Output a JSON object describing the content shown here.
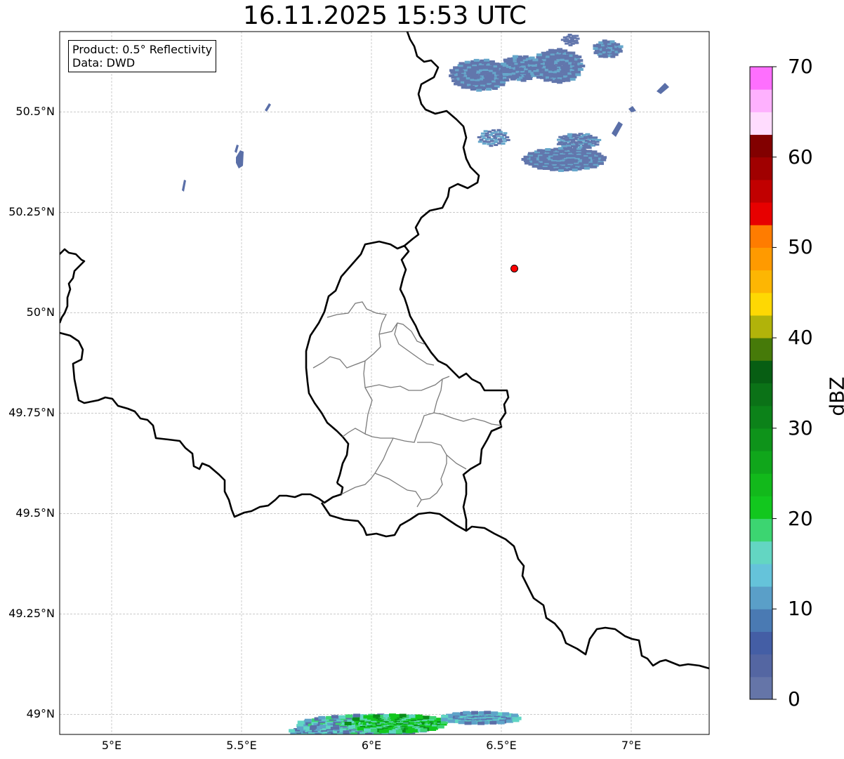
{
  "title": "16.11.2025 15:53 UTC",
  "info": {
    "product": "Product: 0.5° Reflectivity",
    "data": "Data: DWD"
  },
  "map": {
    "lon_range": [
      4.8,
      7.3
    ],
    "lat_range": [
      48.95,
      50.7
    ],
    "lon_ticks": [
      {
        "v": 5.0,
        "label": "5°E"
      },
      {
        "v": 5.5,
        "label": "5.5°E"
      },
      {
        "v": 6.0,
        "label": "6°E"
      },
      {
        "v": 6.5,
        "label": "6.5°E"
      },
      {
        "v": 7.0,
        "label": "7°E"
      }
    ],
    "lat_ticks": [
      {
        "v": 49.0,
        "label": "49°N"
      },
      {
        "v": 49.25,
        "label": "49.25°N"
      },
      {
        "v": 49.5,
        "label": "49.5°N"
      },
      {
        "v": 49.75,
        "label": "49.75°N"
      },
      {
        "v": 50.0,
        "label": "50°N"
      },
      {
        "v": 50.25,
        "label": "50.25°N"
      },
      {
        "v": 50.5,
        "label": "50.5°N"
      }
    ],
    "grid": true,
    "radar_site": {
      "lon": 6.55,
      "lat": 50.11,
      "color": "#ff0000"
    },
    "echo_colors": {
      "low": "#5a6fa8",
      "mid": "#5ea3c9",
      "teal": "#60d5c4",
      "green": "#3cd471",
      "green2": "#12c71e",
      "green3": "#0a8c1a"
    }
  },
  "colorbar": {
    "label": "dBZ",
    "min": 0,
    "max": 70,
    "ticks": [
      "0",
      "10",
      "20",
      "30",
      "40",
      "50",
      "60",
      "70"
    ],
    "colors": [
      "#6575a8",
      "#5466a2",
      "#445ea5",
      "#4a7ab3",
      "#5a9fc8",
      "#65c3da",
      "#63d6c2",
      "#3cd571",
      "#12c71e",
      "#12b91b",
      "#10a61b",
      "#0e931a",
      "#0c8219",
      "#0b7217",
      "#075e13",
      "#467a09",
      "#b1b30a",
      "#fed803",
      "#fdb603",
      "#ff9a00",
      "#ff7c00",
      "#e70000",
      "#c10000",
      "#a00000",
      "#820000",
      "#ffdcfe",
      "#feb1fe",
      "#fe6ffe",
      "#ea3ae9"
    ]
  }
}
